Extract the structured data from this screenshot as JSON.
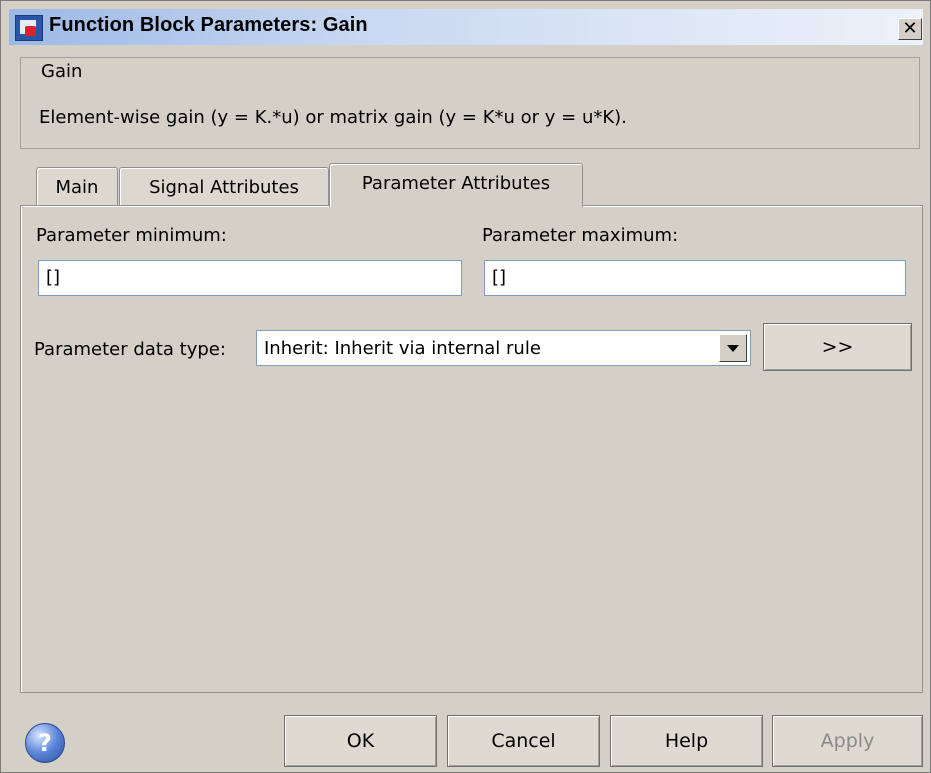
{
  "window": {
    "title": "Function Block Parameters: Gain",
    "close_glyph": "✕"
  },
  "group": {
    "legend": "Gain",
    "description": "Element-wise gain (y = K.*u) or matrix gain (y = K*u or y = u*K)."
  },
  "tabs": [
    {
      "label": "Main",
      "active": false
    },
    {
      "label": "Signal Attributes",
      "active": false
    },
    {
      "label": "Parameter Attributes",
      "active": true
    }
  ],
  "panel": {
    "param_min_label": "Parameter minimum:",
    "param_min_value": "[]",
    "param_max_label": "Parameter maximum:",
    "param_max_value": "[]",
    "data_type_label": "Parameter data type:",
    "data_type_value": "Inherit: Inherit via internal rule",
    "assistant_button": ">>"
  },
  "buttons": {
    "ok": "OK",
    "cancel": "Cancel",
    "help": "Help",
    "apply": "Apply",
    "apply_enabled": false
  },
  "help_icon": {
    "glyph": "?",
    "name": "help-icon"
  },
  "colors": {
    "dialog_bg": "#d4d0c8",
    "titlebar_start": "#9db9e6",
    "disabled_text": "#8a8a8a"
  }
}
